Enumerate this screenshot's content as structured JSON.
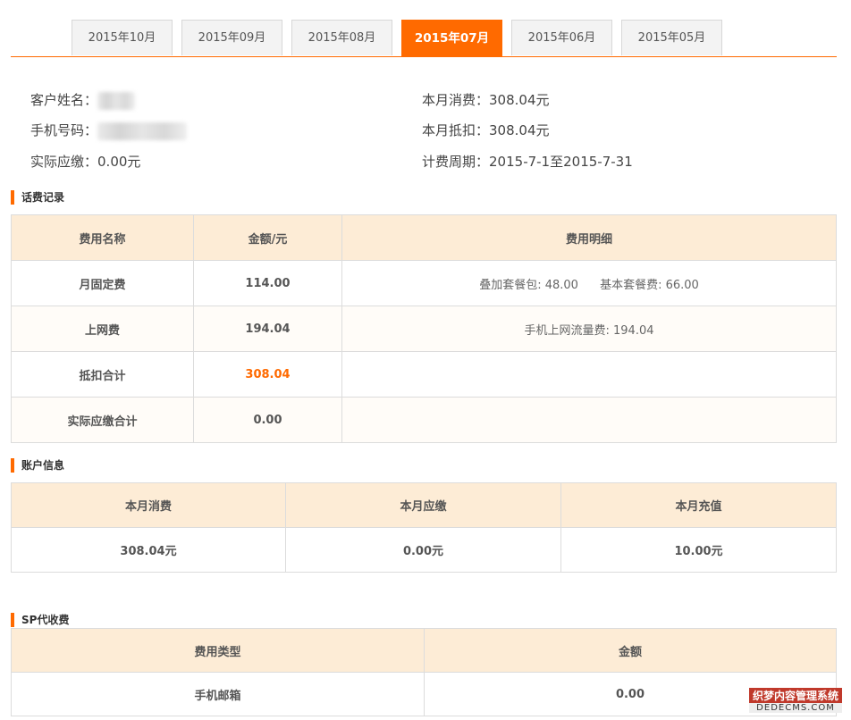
{
  "tabs": [
    {
      "label": "2015年10月",
      "active": false
    },
    {
      "label": "2015年09月",
      "active": false
    },
    {
      "label": "2015年08月",
      "active": false
    },
    {
      "label": "2015年07月",
      "active": true
    },
    {
      "label": "2015年06月",
      "active": false
    },
    {
      "label": "2015年05月",
      "active": false
    }
  ],
  "customer": {
    "name_label": "客户姓名：",
    "phone_label": "手机号码：",
    "actual_label": "实际应缴：",
    "actual_value": "0.00元",
    "month_spend_label": "本月消费：",
    "month_spend_value": "308.04元",
    "month_deduct_label": "本月抵扣：",
    "month_deduct_value": "308.04元",
    "period_label": "计费周期：",
    "period_value": "2015-7-1至2015-7-31"
  },
  "fee_section": {
    "title": "话费记录",
    "headers": [
      "费用名称",
      "金额/元",
      "费用明细"
    ],
    "rows": [
      {
        "name": "月固定费",
        "amount": "114.00",
        "details": [
          "叠加套餐包: 48.00",
          "基本套餐费: 66.00"
        ]
      },
      {
        "name": "上网费",
        "amount": "194.04",
        "details": [
          "手机上网流量费: 194.04"
        ]
      },
      {
        "name": "抵扣合计",
        "amount": "308.04",
        "details": []
      },
      {
        "name": "实际应缴合计",
        "amount": "0.00",
        "details": []
      }
    ]
  },
  "account_section": {
    "title": "账户信息",
    "headers": [
      "本月消费",
      "本月应缴",
      "本月充值"
    ],
    "values": [
      "308.04元",
      "0.00元",
      "10.00元"
    ]
  },
  "sp_section": {
    "title": "SP代收费",
    "headers": [
      "费用类型",
      "金额"
    ],
    "rows": [
      {
        "type": "手机邮箱",
        "amount": "0.00"
      }
    ]
  },
  "watermark": {
    "line1": "织梦内容管理系统",
    "line2": "DEDECMS.COM"
  },
  "colors": {
    "accent": "#ff6a00",
    "header_bg": "#fdecd6"
  }
}
